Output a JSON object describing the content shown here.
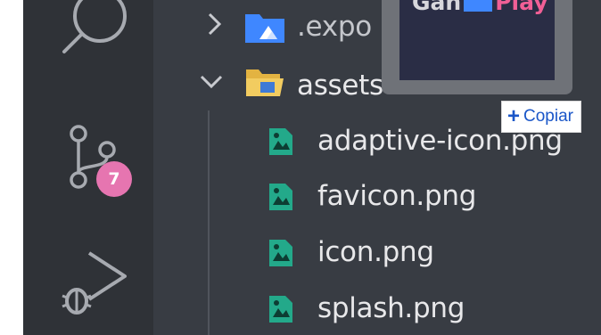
{
  "activity_bar": {
    "source_control_badge": "7",
    "icons": [
      "search-icon",
      "source-control-icon",
      "run-debug-icon"
    ]
  },
  "explorer": {
    "tree": [
      {
        "label": ".expo",
        "type": "folder",
        "expanded": false,
        "icon": "expo-folder-icon"
      },
      {
        "label": "assets",
        "type": "folder",
        "expanded": true,
        "icon": "assets-folder-icon"
      },
      {
        "label": "adaptive-icon.png",
        "type": "file",
        "icon": "image-file-icon"
      },
      {
        "label": "favicon.png",
        "type": "file",
        "icon": "image-file-icon"
      },
      {
        "label": "icon.png",
        "type": "file",
        "icon": "image-file-icon"
      },
      {
        "label": "splash.png",
        "type": "file",
        "icon": "image-file-icon"
      }
    ]
  },
  "overlay": {
    "thumbnail_text_left": "Gan",
    "thumbnail_text_right": "Play",
    "copy_button_label": "Copiar"
  },
  "colors": {
    "activity_bar_bg": "#2f3237",
    "explorer_bg": "#383c43",
    "badge": "#e675b0",
    "folder": "#e3b341",
    "image_file": "#23a98a",
    "expo_folder": "#3f87ff",
    "copy_accent": "#1a56c8"
  }
}
